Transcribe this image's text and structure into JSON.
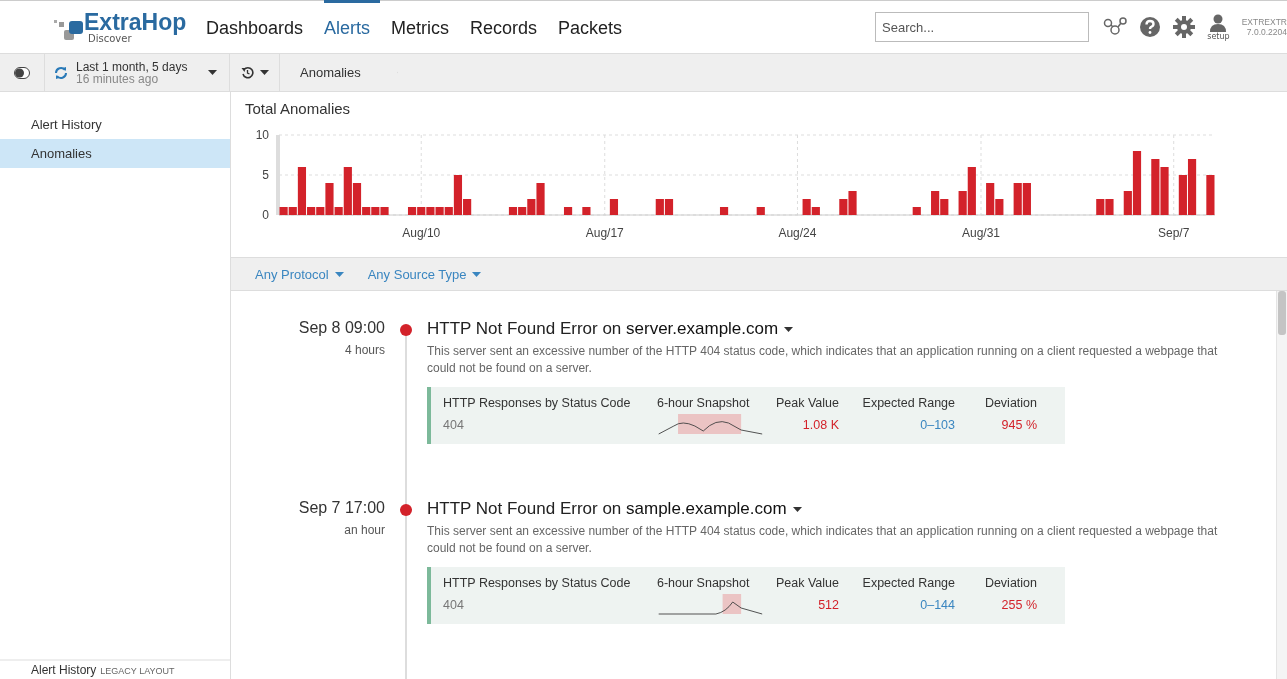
{
  "header": {
    "logo": "ExtraHop",
    "logo_sub": "Discover",
    "nav": [
      {
        "label": "Dashboards",
        "selected": false
      },
      {
        "label": "Alerts",
        "selected": true
      },
      {
        "label": "Metrics",
        "selected": false
      },
      {
        "label": "Records",
        "selected": false
      },
      {
        "label": "Packets",
        "selected": false
      }
    ],
    "search": {
      "placeholder": "Search..."
    },
    "user_label": "setup",
    "system": "EXTREXTR",
    "version": "7.0.0.2204"
  },
  "toolbar": {
    "time_range": "Last 1 month, 5 days",
    "updated": "16 minutes ago",
    "breadcrumb": "Anomalies"
  },
  "sidebar": {
    "items": [
      {
        "label": "Alert History",
        "selected": false
      },
      {
        "label": "Anomalies",
        "selected": true
      }
    ],
    "footer": "Alert History",
    "footer_tag": "LEGACY LAYOUT"
  },
  "chart_panel": {
    "chart_data": {
      "type": "bar",
      "title": "Total Anomalies",
      "categories": [
        null,
        null,
        null,
        null,
        null,
        null,
        null,
        null,
        null,
        null,
        null,
        null,
        null,
        null,
        null,
        "Aug/10",
        null,
        null,
        null,
        null,
        null,
        null,
        null,
        null,
        null,
        null,
        null,
        null,
        null,
        null,
        null,
        null,
        null,
        null,
        null,
        "Aug/17",
        null,
        null,
        null,
        null,
        null,
        null,
        null,
        null,
        null,
        null,
        null,
        null,
        null,
        null,
        null,
        null,
        null,
        null,
        null,
        null,
        "Aug/24",
        null,
        null,
        null,
        null,
        null,
        null,
        null,
        null,
        null,
        null,
        null,
        null,
        null,
        null,
        null,
        null,
        null,
        null,
        null,
        "Aug/31",
        null,
        null,
        null,
        null,
        null,
        null,
        null,
        null,
        null,
        null,
        null,
        null,
        null,
        null,
        null,
        null,
        null,
        null,
        null,
        null,
        "Sep/7",
        null,
        null,
        null,
        null
      ],
      "series": [
        {
          "color": "#d3222a",
          "values": [
            1,
            1,
            6,
            1,
            1,
            4,
            1,
            6,
            4,
            1,
            1,
            1,
            null,
            null,
            1,
            1,
            1,
            1,
            1,
            5,
            2,
            null,
            null,
            null,
            null,
            1,
            1,
            2,
            4,
            null,
            null,
            1,
            null,
            1,
            null,
            null,
            2,
            null,
            null,
            null,
            null,
            2,
            2,
            null,
            null,
            null,
            null,
            null,
            1,
            null,
            null,
            null,
            1,
            null,
            null,
            null,
            null,
            2,
            1,
            null,
            null,
            2,
            3,
            null,
            null,
            null,
            null,
            null,
            null,
            1,
            null,
            3,
            2,
            null,
            3,
            6,
            null,
            4,
            2,
            null,
            4,
            4,
            null,
            null,
            null,
            null,
            null,
            null,
            null,
            2,
            2,
            null,
            3,
            8,
            null,
            7,
            6,
            null,
            5,
            7,
            null,
            5
          ]
        }
      ],
      "ylim": [
        0,
        10
      ],
      "yticks": [
        0,
        5,
        10
      ],
      "grid": true
    }
  },
  "filters": [
    "Any Protocol",
    "Any Source Type"
  ],
  "alerts": [
    {
      "time": "Sep 8 09:00",
      "ago": "4 hours",
      "title": "HTTP Not Found Error on ",
      "host": "server.example.com",
      "description": "This server sent an excessive number of the HTTP 404 status code, which indicates that an application running on a client requested a webpage that could not be found on a server.",
      "metric": {
        "columns": [
          "HTTP Responses by Status Code",
          "6-hour Snapshot",
          "Peak Value",
          "Expected Range",
          "Deviation"
        ],
        "name": "404",
        "peak": "1.08 K",
        "range": "0–103",
        "deviation": "945 %"
      }
    },
    {
      "time": "Sep 7 17:00",
      "ago": "an hour",
      "title": "HTTP Not Found Error on ",
      "host": "sample.example.com",
      "description": "This server sent an excessive number of the HTTP 404 status code, which indicates that an application running on a client requested a webpage that could not be found on a server.",
      "metric": {
        "columns": [
          "HTTP Responses by Status Code",
          "6-hour Snapshot",
          "Peak Value",
          "Expected Range",
          "Deviation"
        ],
        "name": "404",
        "peak": "512",
        "range": "0–144",
        "deviation": "255 %"
      }
    }
  ]
}
